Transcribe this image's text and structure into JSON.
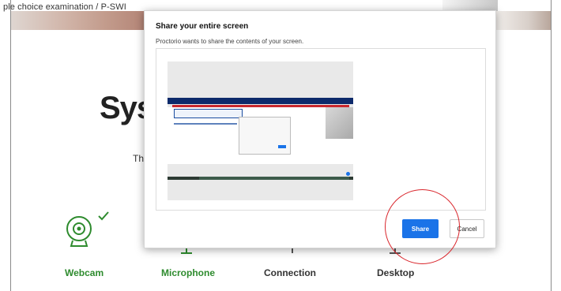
{
  "page": {
    "breadcrumb": "ple choice examination  /  P-SWI",
    "title": "Syst",
    "intro_text": "Th",
    "checks": [
      {
        "label": "Webcam",
        "status": "passed"
      },
      {
        "label": "Microphone",
        "status": "passed"
      },
      {
        "label": "Connection",
        "status": "pending"
      },
      {
        "label": "Desktop",
        "status": "pending"
      }
    ]
  },
  "dialog": {
    "title": "Share your entire screen",
    "subtitle": "Proctorio wants to share the contents of your screen.",
    "share_label": "Share",
    "cancel_label": "Cancel"
  },
  "colors": {
    "accent": "#1a73e8",
    "success": "#2e8b2e",
    "annotation": "#d9262c"
  },
  "icons": {
    "webcam": "webcam-icon",
    "check": "checkmark-icon",
    "microphone": "microphone-icon",
    "connection": "connection-icon",
    "desktop": "desktop-icon"
  }
}
